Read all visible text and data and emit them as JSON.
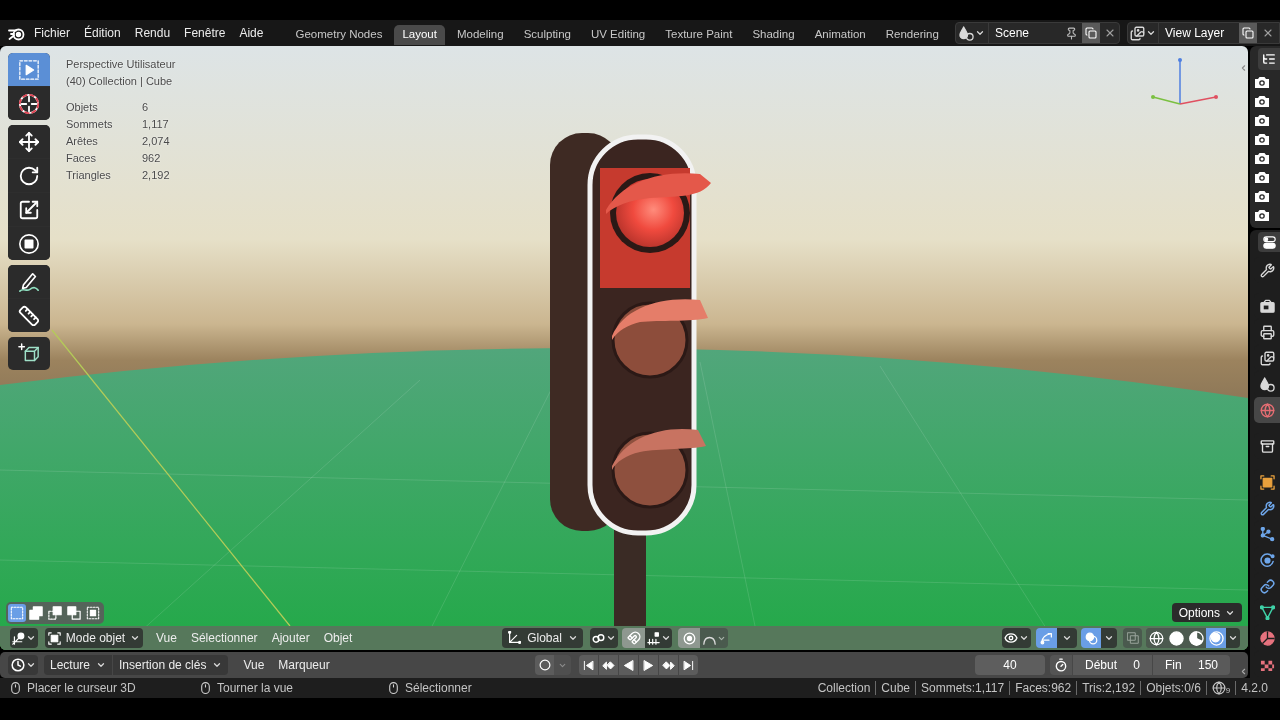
{
  "menu_bar": {
    "items": [
      "Fichier",
      "Édition",
      "Rendu",
      "Fenêtre",
      "Aide"
    ]
  },
  "workspace_tabs": [
    {
      "label": "Geometry Nodes",
      "selected": false
    },
    {
      "label": "Layout",
      "selected": true
    },
    {
      "label": "Modeling",
      "selected": false
    },
    {
      "label": "Sculpting",
      "selected": false
    },
    {
      "label": "UV Editing",
      "selected": false
    },
    {
      "label": "Texture Paint",
      "selected": false
    },
    {
      "label": "Shading",
      "selected": false
    },
    {
      "label": "Animation",
      "selected": false
    },
    {
      "label": "Rendering",
      "selected": false
    }
  ],
  "scene_selector": {
    "value": "Scene"
  },
  "view_layer_selector": {
    "value": "View Layer"
  },
  "viewport": {
    "overlay_text": {
      "view": "Perspective Utilisateur",
      "context": "(40) Collection | Cube"
    },
    "statistics": [
      {
        "label": "Objets",
        "value": "6"
      },
      {
        "label": "Sommets",
        "value": "1,117"
      },
      {
        "label": "Arêtes",
        "value": "2,074"
      },
      {
        "label": "Faces",
        "value": "962"
      },
      {
        "label": "Triangles",
        "value": "2,192"
      }
    ],
    "tool_groups": [
      [
        {
          "kind": "select_box",
          "selected": true
        },
        {
          "kind": "cursor",
          "selected": false
        }
      ],
      [
        {
          "kind": "move",
          "selected": false
        },
        {
          "kind": "rotate",
          "selected": false
        },
        {
          "kind": "scale",
          "selected": false
        },
        {
          "kind": "transform",
          "selected": false
        }
      ],
      [
        {
          "kind": "annotate",
          "selected": false
        },
        {
          "kind": "measure",
          "selected": false
        }
      ],
      [
        {
          "kind": "add_cube",
          "selected": false
        }
      ]
    ],
    "select_modes": [
      {
        "kind": "set",
        "selected": true
      },
      {
        "kind": "extend",
        "selected": false
      },
      {
        "kind": "subtract",
        "selected": false
      },
      {
        "kind": "invert",
        "selected": false
      },
      {
        "kind": "intersect",
        "selected": false
      }
    ],
    "options_button": "Options",
    "header": {
      "mode": "Mode objet",
      "menus": [
        "Vue",
        "Sélectionner",
        "Ajouter",
        "Objet"
      ],
      "orientation": "Global",
      "snap": false,
      "proportional_editing": false,
      "gizmos": true,
      "overlays": true,
      "xray": false,
      "shading_modes": [
        {
          "kind": "wireframe",
          "selected": false
        },
        {
          "kind": "solid",
          "selected": false
        },
        {
          "kind": "material",
          "selected": false
        },
        {
          "kind": "rendered",
          "selected": true
        }
      ]
    }
  },
  "timeline": {
    "dropdowns": [
      "Lecture",
      "Insertion de clés"
    ],
    "menus": [
      "Vue",
      "Marqueur"
    ],
    "auto_keying": false,
    "current_frame": "40",
    "start": {
      "label": "Début",
      "value": "0"
    },
    "end": {
      "label": "Fin",
      "value": "150"
    }
  },
  "outliner": {
    "render_toggles": [
      {
        "on": true
      },
      {
        "on": true
      },
      {
        "on": true
      },
      {
        "on": true
      },
      {
        "on": true
      },
      {
        "on": true
      },
      {
        "on": true
      },
      {
        "on": true
      }
    ]
  },
  "properties_tabs": [
    [
      {
        "kind": "tool",
        "selected": false
      }
    ],
    [
      {
        "kind": "render",
        "selected": false
      },
      {
        "kind": "output",
        "selected": false
      },
      {
        "kind": "view_layer",
        "selected": false
      },
      {
        "kind": "scene",
        "selected": false
      },
      {
        "kind": "world",
        "selected": true
      }
    ],
    [
      {
        "kind": "collection",
        "selected": false
      }
    ],
    [
      {
        "kind": "object",
        "selected": false
      },
      {
        "kind": "modifiers",
        "selected": false
      },
      {
        "kind": "particles",
        "selected": false
      },
      {
        "kind": "physics",
        "selected": false
      },
      {
        "kind": "constraints",
        "selected": false
      },
      {
        "kind": "data",
        "selected": false
      },
      {
        "kind": "material",
        "selected": false
      },
      {
        "kind": "texture",
        "selected": false
      }
    ]
  ],
  "status_bar": {
    "hints": [
      "Placer le curseur 3D",
      "Tourner la vue",
      "Sélectionner"
    ],
    "scene_stats": [
      "Collection",
      "Cube",
      "Sommets:1,117",
      "Faces:962",
      "Tris:2,192",
      "Objets:0/6"
    ],
    "extension_updates": "9",
    "version": "4.2.0"
  }
}
